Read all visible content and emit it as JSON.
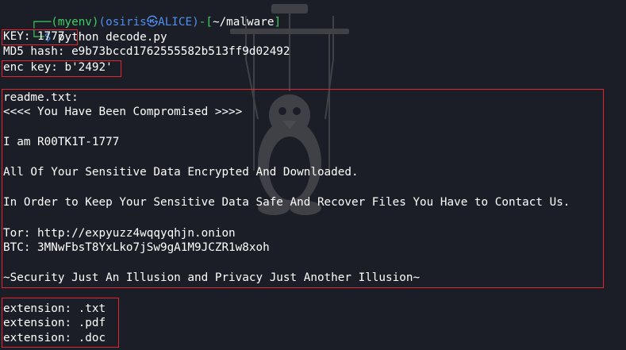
{
  "prompt": {
    "corner": "┌──",
    "env": "(myenv)",
    "user_host_open": "(osiris",
    "host_symbol": "㉿",
    "host": "ALICE",
    "user_host_close": ")",
    "dash": "-",
    "path_open": "[",
    "path": "~/malware",
    "path_close": "]",
    "lower_corner": "└─",
    "dollar": "$",
    "command": " python decode.py"
  },
  "output": {
    "key_line": "KEY: 1777",
    "md5_line": "MD5 hash: e9b73bccd1762555582b513ff9d02492",
    "enc_key_line": "enc key: b'2492'",
    "readme": {
      "filename": "readme.txt:",
      "header": "<<<< You Have Been Compromised >>>>",
      "identity": "I am R00TK1T-1777",
      "encrypted": "All Of Your Sensitive Data Encrypted And Downloaded.",
      "contact": "In Order to Keep Your Sensitive Data Safe And Recover Files You Have to Contact Us.",
      "tor": "Tor: http://expyuzz4wqqyqhjn.onion",
      "btc": "BTC: 3MNwFbsT8YxLko7jSw9gA1M9JCZR1w8xoh",
      "motto": "~Security Just An Illusion and Privacy Just Another Illusion~"
    },
    "extensions": [
      "extension: .txt",
      "extension: .pdf",
      "extension: .doc"
    ]
  },
  "colors": {
    "background": "#1b1e26",
    "prompt_green": "#3fcf63",
    "prompt_blue": "#4f8eef",
    "highlight_red": "#e0262f"
  },
  "watermark_icon": "tux-penguin-marionette-icon"
}
